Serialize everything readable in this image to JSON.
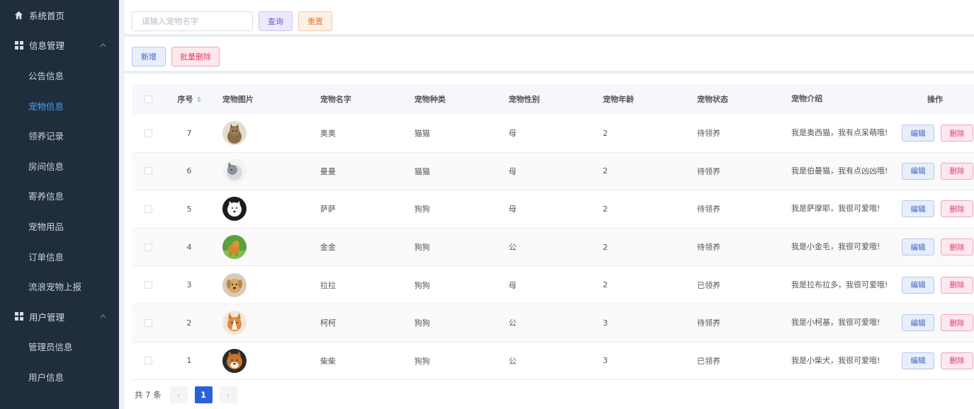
{
  "sidebar": {
    "home": "系统首页",
    "info_group": "信息管理",
    "info_items": [
      "公告信息",
      "宠物信息",
      "领养记录",
      "房间信息",
      "寄养信息",
      "宠物用品",
      "订单信息",
      "流浪宠物上报"
    ],
    "active_item": "宠物信息",
    "user_group": "用户管理",
    "user_items": [
      "管理员信息",
      "用户信息"
    ]
  },
  "search": {
    "placeholder": "请输入宠物名字",
    "value": "",
    "query_label": "查询",
    "reset_label": "重置"
  },
  "actions": {
    "add_label": "新增",
    "batch_delete_label": "批量删除"
  },
  "colors": {
    "sidebar_bg": "#1f2d3d",
    "active_menu": "#409eff",
    "primary_page": "#2962d6"
  },
  "table": {
    "columns": [
      "序号",
      "宠物图片",
      "宠物名字",
      "宠物种类",
      "宠物性别",
      "宠物年龄",
      "宠物状态",
      "宠物介绍",
      "操作"
    ],
    "edit_label": "编辑",
    "delete_label": "删除",
    "rows": [
      {
        "seq": "7",
        "image": "cat-tabby",
        "name": "奥奥",
        "type": "猫猫",
        "sex": "母",
        "age": "2",
        "state": "待领养",
        "intro": "我是奥西猫，我有点呆萌哦!"
      },
      {
        "seq": "6",
        "image": "cat-grey-white",
        "name": "曼曼",
        "type": "猫猫",
        "sex": "母",
        "age": "2",
        "state": "待领养",
        "intro": "我是伯曼猫，我有点凶凶哦!"
      },
      {
        "seq": "5",
        "image": "dog-samoyed",
        "name": "萨萨",
        "type": "狗狗",
        "sex": "母",
        "age": "2",
        "state": "待领养",
        "intro": "我是萨摩耶，我很可爱哦!"
      },
      {
        "seq": "4",
        "image": "dog-golden-retriever",
        "name": "金金",
        "type": "狗狗",
        "sex": "公",
        "age": "2",
        "state": "待领养",
        "intro": "我是小金毛，我很可爱哦!"
      },
      {
        "seq": "3",
        "image": "dog-labrador",
        "name": "拉拉",
        "type": "狗狗",
        "sex": "母",
        "age": "2",
        "state": "已领养",
        "intro": "我是拉布拉多，我很可爱哦!"
      },
      {
        "seq": "2",
        "image": "dog-corgi",
        "name": "柯柯",
        "type": "狗狗",
        "sex": "公",
        "age": "3",
        "state": "待领养",
        "intro": "我是小柯基，我很可爱哦!"
      },
      {
        "seq": "1",
        "image": "dog-shiba",
        "name": "柴柴",
        "type": "狗狗",
        "sex": "公",
        "age": "3",
        "state": "已领养",
        "intro": "我是小柴犬，我很可爱哦!"
      }
    ]
  },
  "pagination": {
    "total_label": "共 7 条",
    "prev_icon": "‹",
    "current_page": "1",
    "next_icon": "›"
  }
}
